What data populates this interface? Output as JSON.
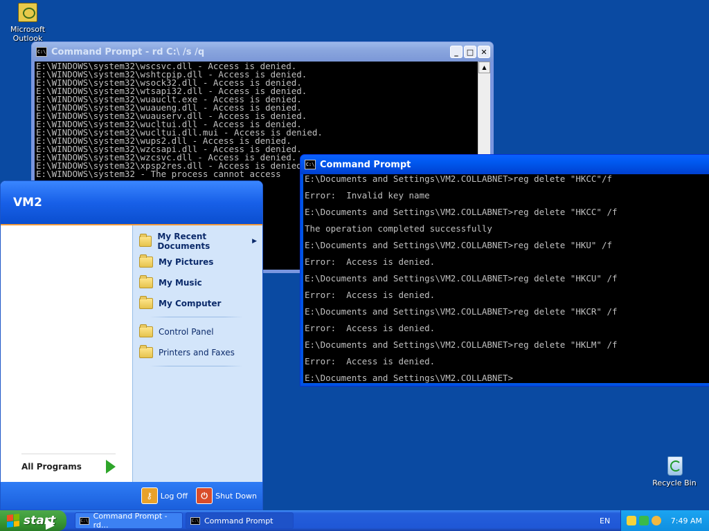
{
  "desktop": {
    "icons": [
      {
        "label": "Microsoft Outlook",
        "icon": "outlook-icon"
      },
      {
        "label": "Recycle Bin",
        "icon": "recycle-bin-icon"
      }
    ]
  },
  "window1": {
    "title": "Command Prompt - rd C:\\ /s /q",
    "icon_label": "C:\\",
    "lines": [
      "E:\\WINDOWS\\system32\\wscsvc.dll - Access is denied.",
      "E:\\WINDOWS\\system32\\wshtcpip.dll - Access is denied.",
      "E:\\WINDOWS\\system32\\wsock32.dll - Access is denied.",
      "E:\\WINDOWS\\system32\\wtsapi32.dll - Access is denied.",
      "E:\\WINDOWS\\system32\\wuauclt.exe - Access is denied.",
      "E:\\WINDOWS\\system32\\wuaueng.dll - Access is denied.",
      "E:\\WINDOWS\\system32\\wuauserv.dll - Access is denied.",
      "E:\\WINDOWS\\system32\\wucltui.dll - Access is denied.",
      "E:\\WINDOWS\\system32\\wucltui.dll.mui - Access is denied.",
      "E:\\WINDOWS\\system32\\wups2.dll - Access is denied.",
      "E:\\WINDOWS\\system32\\wzcsapi.dll - Access is denied.",
      "E:\\WINDOWS\\system32\\wzcsvc.dll - Access is denied.",
      "E:\\WINDOWS\\system32\\xpsp2res.dll - Access is denied.",
      "E:\\WINDOWS\\system32 - The process cannot access"
    ]
  },
  "window2": {
    "title": "Command Prompt",
    "icon_label": "C:\\",
    "lines": [
      "E:\\Documents and Settings\\VM2.COLLABNET>reg delete \"HKCC\"/f",
      "Error:  Invalid key name",
      "E:\\Documents and Settings\\VM2.COLLABNET>reg delete \"HKCC\" /f",
      "The operation completed successfully",
      "E:\\Documents and Settings\\VM2.COLLABNET>reg delete \"HKU\" /f",
      "Error:  Access is denied.",
      "E:\\Documents and Settings\\VM2.COLLABNET>reg delete \"HKCU\" /f",
      "Error:  Access is denied.",
      "E:\\Documents and Settings\\VM2.COLLABNET>reg delete \"HKCR\" /f",
      "Error:  Access is denied.",
      "E:\\Documents and Settings\\VM2.COLLABNET>reg delete \"HKLM\" /f",
      "Error:  Access is denied.",
      "E:\\Documents and Settings\\VM2.COLLABNET>"
    ]
  },
  "start_menu": {
    "user": "VM2",
    "all_programs": "All Programs",
    "right_items": [
      {
        "label": "My Recent Documents",
        "bold": true,
        "submenu": true
      },
      {
        "label": "My Pictures",
        "bold": true
      },
      {
        "label": "My Music",
        "bold": true
      },
      {
        "label": "My Computer",
        "bold": true
      },
      {
        "label": "Control Panel",
        "bold": false
      },
      {
        "label": "Printers and Faxes",
        "bold": false
      }
    ],
    "log_off": "Log Off",
    "shut_down": "Shut Down"
  },
  "taskbar": {
    "start_label": "start",
    "tasks": [
      {
        "label": "Command Prompt - rd..."
      },
      {
        "label": "Command Prompt"
      }
    ],
    "language": "EN",
    "clock": "7:49 AM"
  }
}
